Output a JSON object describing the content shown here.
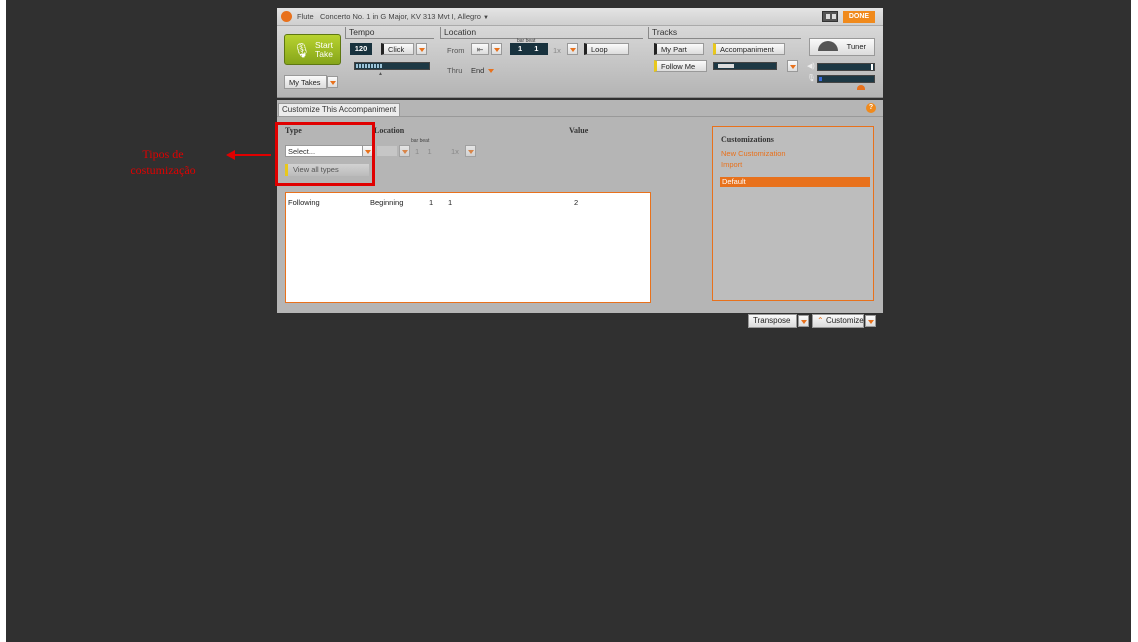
{
  "titlebar": {
    "instrument": "Flute",
    "piece": "Concerto No. 1 in G Major, KV 313 Mvt I, Allegro",
    "done": "DONE"
  },
  "toolbar": {
    "start_take": [
      "Start",
      "Take"
    ],
    "my_takes": "My Takes",
    "tempo": {
      "label": "Tempo",
      "value": "120",
      "click": "Click"
    },
    "location": {
      "label": "Location",
      "from": "From",
      "thru": "Thru",
      "end": "End",
      "bar_beat": "bar  beat",
      "bar": "1",
      "beat": "1",
      "repeat": "1x",
      "loop": "Loop"
    },
    "tracks": {
      "label": "Tracks",
      "my_part": "My Part",
      "accompaniment": "Accompaniment",
      "follow_me": "Follow Me"
    },
    "tuner": "Tuner"
  },
  "panel": {
    "tab": "Customize This Accompaniment",
    "headers": {
      "type": "Type",
      "location": "Location",
      "value": "Value"
    },
    "type_select": "Select...",
    "bar_beat": "bar  beat",
    "loc_bar": "1",
    "loc_beat": "1",
    "loc_repeat": "1x",
    "view_all": "View all types",
    "rows": [
      {
        "type": "Following",
        "location": "Beginning",
        "bar": "1",
        "beat": "1",
        "value": "2"
      }
    ],
    "customizations": {
      "title": "Customizations",
      "new": "New Customization",
      "import": "Import",
      "default": "Default"
    }
  },
  "bottom": {
    "transpose": "Transpose",
    "customize": "Customize"
  },
  "annotation": [
    "Tipos de",
    "costumização"
  ],
  "colors": {
    "accent": "#e8711c",
    "annotation": "#e00000",
    "start_green": "#9ab822",
    "lcd": "#18323e"
  }
}
